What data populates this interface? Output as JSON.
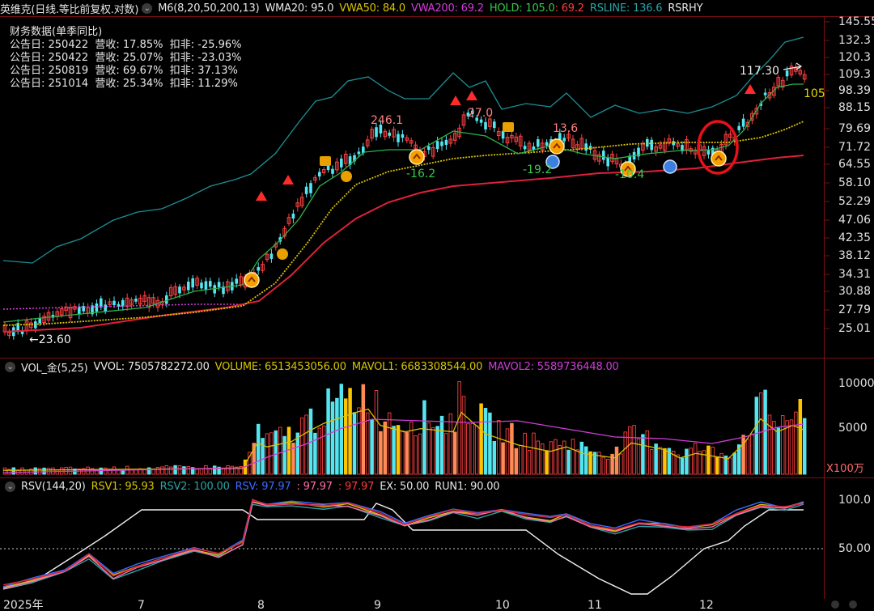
{
  "main_header": {
    "stock_title": "英维克(日线.等比前复权.对数)",
    "m6": "M6(8,20,50,200,13)",
    "wma20": "WMA20: 95.0",
    "vwa50": "VWA50: 84.0",
    "vwa200": "VWA200: 69.2",
    "hold_label": "HOLD: 105.0",
    "hold_value": ": 69.2",
    "rsline": "RSLINE: 136.6",
    "rsrhy": "RSRHY"
  },
  "financial": {
    "title": "财务数据(单季同比)",
    "rows": [
      "公告日: 250422  营收: 17.85%  扣非: -25.96%",
      "公告日: 250422  营收: 25.07%  扣非: -23.03%",
      "公告日: 250819  营收: 69.67%  扣非: 37.13%",
      "公告日: 251014  营收: 25.34%  扣非: 11.29%"
    ]
  },
  "price_axis": [
    "145.55",
    "132.3",
    "120.3",
    "109.3",
    "98.39",
    "88.15",
    "79.69",
    "71.72",
    "64.55",
    "58.10",
    "52.29",
    "47.06",
    "42.35",
    "38.12",
    "34.31",
    "30.88",
    "27.79",
    "25.01"
  ],
  "annotations": {
    "low": "←23.60",
    "a246": "246.1",
    "a27": "27.0",
    "a136": "13.6",
    "a192": "-19.2",
    "a162": "-16.2",
    "a104": "-10.4",
    "high": "117.30",
    "hold_tag": "105"
  },
  "vol_header": {
    "name": "VOL_金(5,25)",
    "vvol": "VVOL: 7505782272.00",
    "volume": "VOLUME: 6513453056.00",
    "mavol1": "MAVOL1: 6683308544.00",
    "mavol2": "MAVOL2: 5589736448.00"
  },
  "vol_axis": [
    "10000",
    "5000"
  ],
  "vol_unit": "X100万",
  "rsv_header": {
    "name": "RSV(144,20)",
    "rsv1": "RSV1: 95.93",
    "rsv2": "RSV2: 100.00",
    "rsv": "RSV: 97.97",
    "v2": ": 97.97",
    "v3": ": 97.97",
    "ex": "EX: 50.00",
    "run1": "RUN1: 90.00"
  },
  "rsv_axis": [
    "100.0",
    "50.00"
  ],
  "time_axis": [
    "2025年",
    "7",
    "8",
    "9",
    "10",
    "11",
    "12"
  ],
  "colors": {
    "up": "#ff4040",
    "down": "#54e6f0",
    "ma_green": "#2bb34a",
    "ma_yellow": "#d9c300",
    "ma_red": "#e0203a",
    "ma_magenta": "#d23cd8",
    "band": "#1c8f93",
    "grid": "#7a1010"
  }
}
